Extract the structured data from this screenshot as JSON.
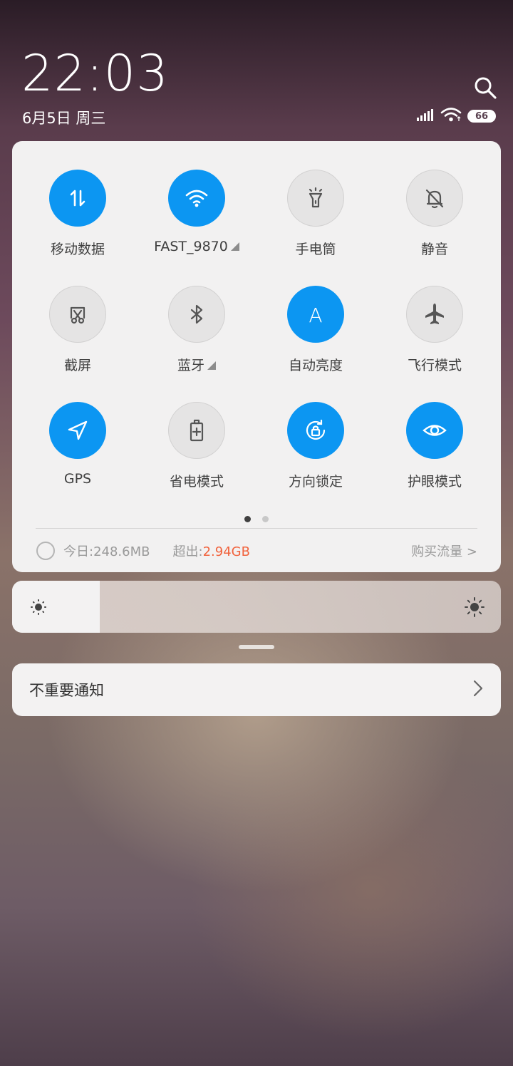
{
  "status": {
    "time": "22:03",
    "date": "6月5日 周三",
    "battery": "66"
  },
  "tiles": [
    {
      "label": "移动数据",
      "icon": "mobile-data-icon",
      "on": true
    },
    {
      "label": "FAST_9870",
      "icon": "wifi-icon",
      "on": true,
      "expand": true
    },
    {
      "label": "手电筒",
      "icon": "flashlight-icon",
      "on": false
    },
    {
      "label": "静音",
      "icon": "mute-bell-icon",
      "on": false
    },
    {
      "label": "截屏",
      "icon": "screenshot-icon",
      "on": false
    },
    {
      "label": "蓝牙",
      "icon": "bluetooth-icon",
      "on": false,
      "expand": true
    },
    {
      "label": "自动亮度",
      "icon": "auto-brightness-icon",
      "on": true
    },
    {
      "label": "飞行模式",
      "icon": "airplane-icon",
      "on": false
    },
    {
      "label": "GPS",
      "icon": "gps-icon",
      "on": true
    },
    {
      "label": "省电模式",
      "icon": "battery-saver-icon",
      "on": false
    },
    {
      "label": "方向锁定",
      "icon": "rotation-lock-icon",
      "on": true
    },
    {
      "label": "护眼模式",
      "icon": "eye-icon",
      "on": true
    }
  ],
  "pager": {
    "pages": 2,
    "current": 1
  },
  "usage": {
    "today": "今日:248.6MB",
    "exceed_label": "超出:",
    "exceed_value": "2.94GB",
    "buy": "购买流量 >"
  },
  "brightness": {
    "level": 0.18
  },
  "notification": {
    "label": "不重要通知"
  },
  "colors": {
    "accent": "#0c96f2",
    "exceed": "#f1633d"
  }
}
